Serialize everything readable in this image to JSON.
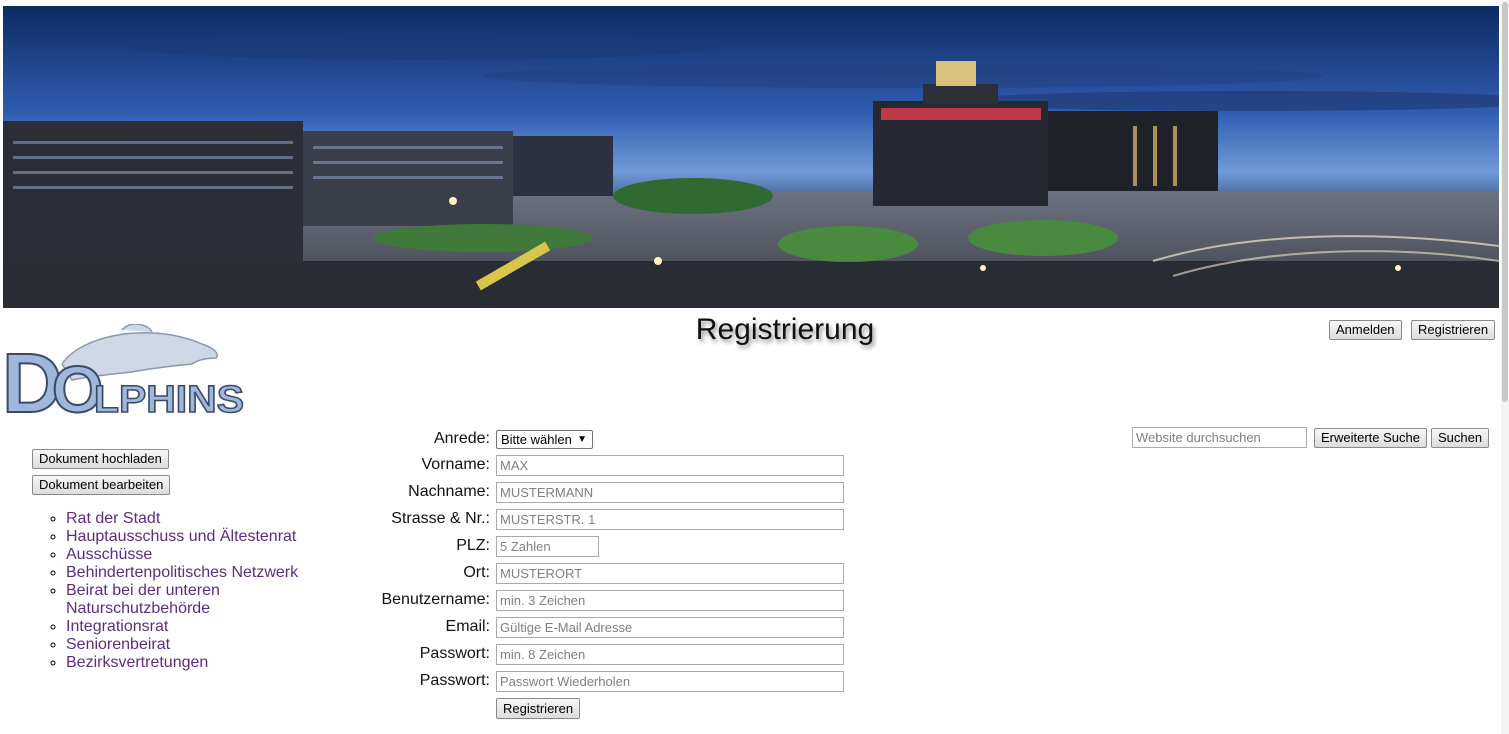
{
  "banner": {
    "alt": "Stadtansicht bei Nacht mit Dortmunder U"
  },
  "logo": {
    "big_d": "D",
    "o": "O",
    "rest": "LPHINS"
  },
  "header": {
    "title": "Registrierung",
    "login_label": "Anmelden",
    "register_label": "Registrieren"
  },
  "search": {
    "placeholder": "Website durchsuchen",
    "advanced_label": "Erweiterte Suche",
    "search_label": "Suchen"
  },
  "sidebar": {
    "upload_label": "Dokument hochladen",
    "edit_label": "Dokument bearbeiten",
    "items": [
      {
        "label": "Rat der Stadt"
      },
      {
        "label": "Hauptausschuss und Ältestenrat"
      },
      {
        "label": "Ausschüsse"
      },
      {
        "label": "Behindertenpolitisches Netzwerk"
      },
      {
        "label": "Beirat bei der unteren Naturschutzbehörde"
      },
      {
        "label": "Integrationsrat"
      },
      {
        "label": "Seniorenbeirat"
      },
      {
        "label": "Bezirksvertretungen"
      }
    ]
  },
  "form": {
    "anrede": {
      "label": "Anrede:",
      "value": "Bitte wählen"
    },
    "vorname": {
      "label": "Vorname:",
      "placeholder": "MAX"
    },
    "nachname": {
      "label": "Nachname:",
      "placeholder": "MUSTERMANN"
    },
    "strasse": {
      "label": "Strasse & Nr.:",
      "placeholder": "MUSTERSTR. 1"
    },
    "plz": {
      "label": "PLZ:",
      "placeholder": "5 Zahlen"
    },
    "ort": {
      "label": "Ort:",
      "placeholder": "MUSTERORT"
    },
    "benutzername": {
      "label": "Benutzername:",
      "placeholder": "min. 3 Zeichen"
    },
    "email": {
      "label": "Email:",
      "placeholder": "Gültige E-Mail Adresse"
    },
    "passwort": {
      "label": "Passwort:",
      "placeholder": "min. 8 Zeichen"
    },
    "passwort2": {
      "label": "Passwort:",
      "placeholder": "Passwort Wiederholen"
    },
    "submit_label": "Registrieren"
  }
}
